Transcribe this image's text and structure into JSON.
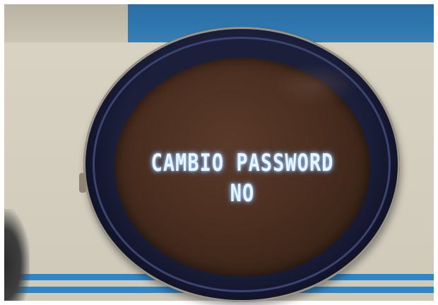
{
  "display": {
    "line1": "CAMBIO PASSWORD",
    "line2": "NO"
  },
  "colors": {
    "panel": "#d6d0c1",
    "blue_stripe": "#2f86c6",
    "bezel": "#1b1f3a",
    "display_glass": "#4a2e20",
    "led_text": "#e8f4ff"
  }
}
